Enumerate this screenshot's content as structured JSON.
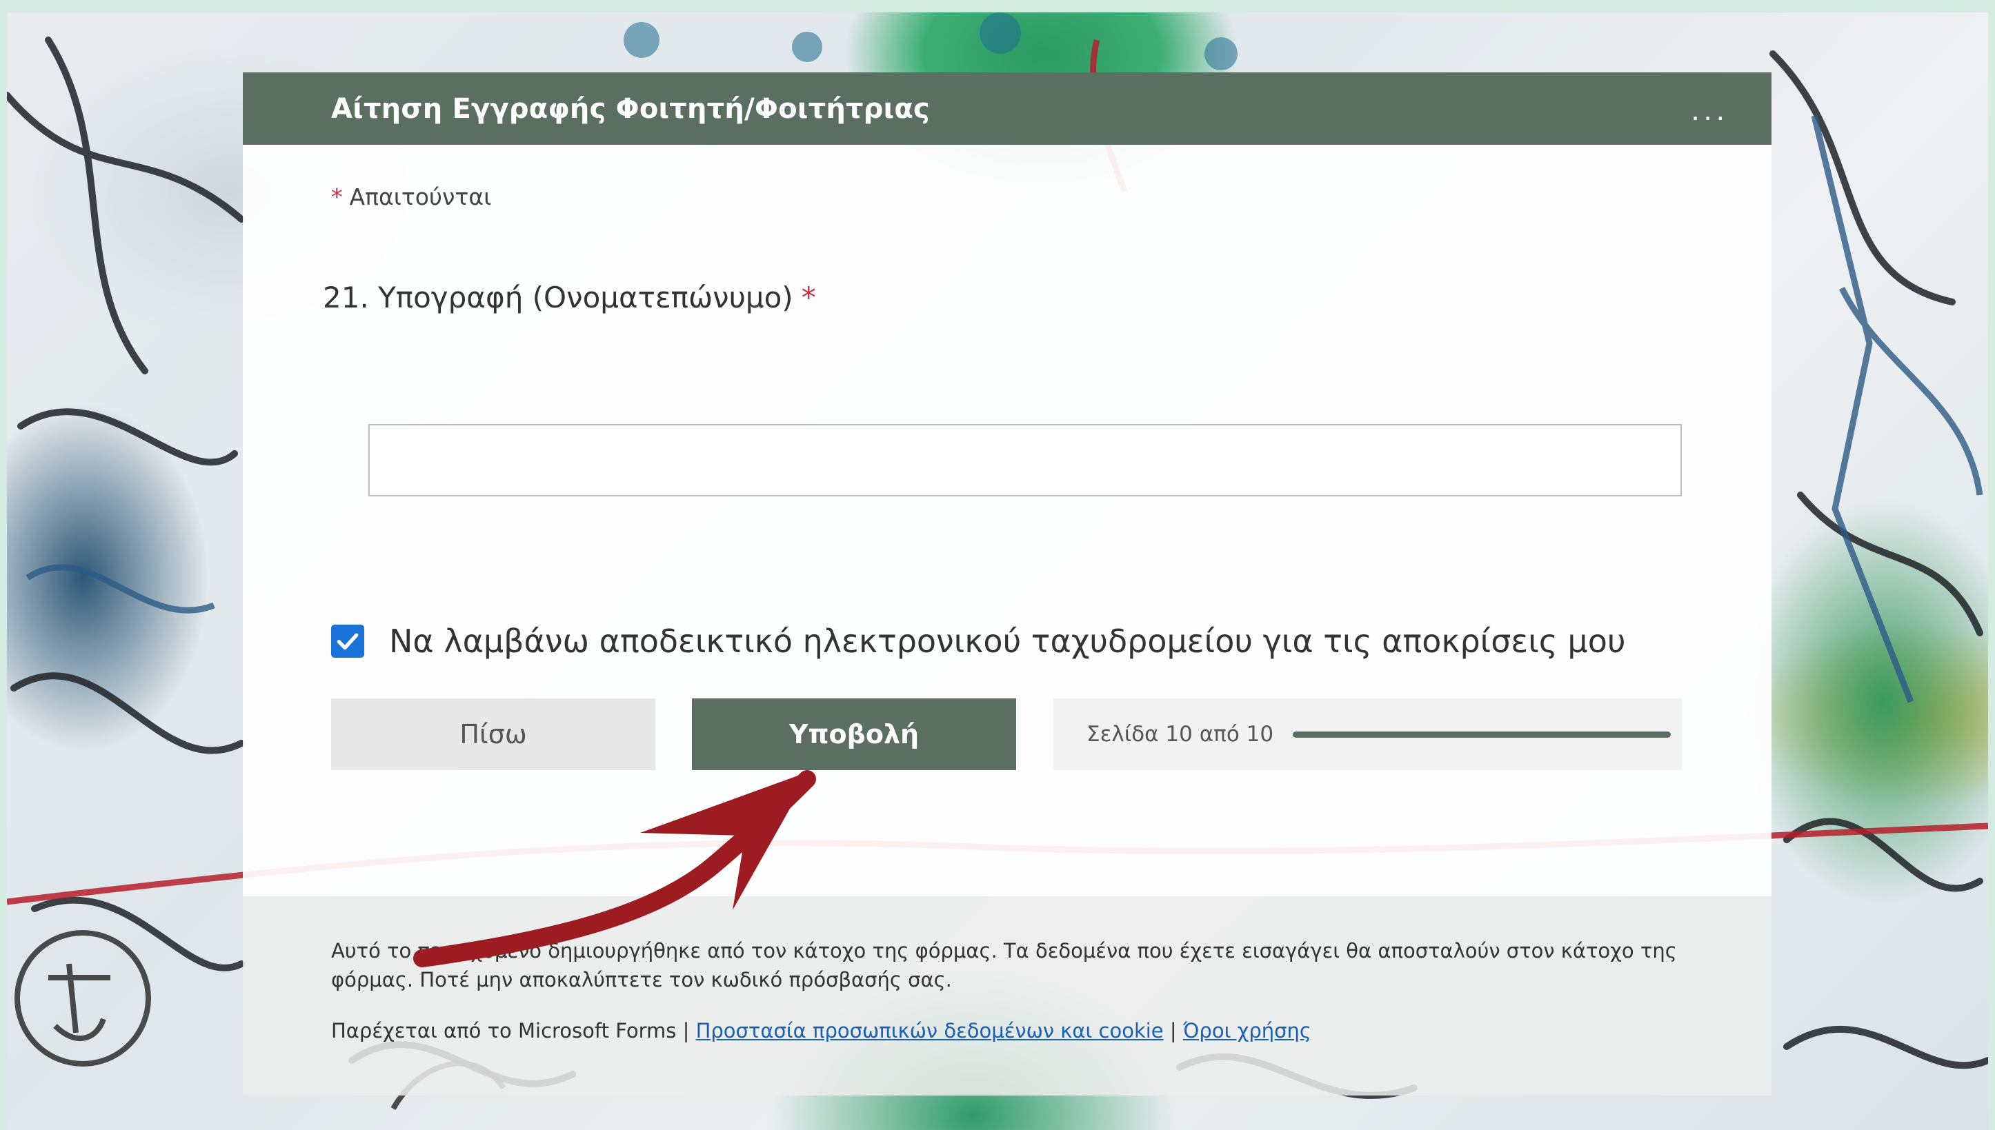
{
  "form": {
    "title": "Αίτηση Εγγραφής Φοιτητή/Φοιτήτριας",
    "more_icon": "more-horizontal-icon",
    "more_label": "...",
    "required_asterisk": "*",
    "required_note": "Απαιτούνται",
    "question": {
      "number_and_text": "21. Υπογραφή (Ονοματεπώνυμο)",
      "asterisk": "*",
      "value": "",
      "placeholder": ""
    },
    "receipt": {
      "checked": true,
      "icon": "checkmark-icon",
      "label": "Να λαμβάνω αποδεικτικό ηλεκτρονικού ταχυδρομείου για τις αποκρίσεις μου"
    },
    "back_label": "Πίσω",
    "submit_label": "Υποβολή",
    "progress": {
      "label": "Σελίδα 10 από 10",
      "current_page": 10,
      "total_pages": 10,
      "fraction": 1.0
    }
  },
  "footer": {
    "disclaimer": "Αυτό το περιεχόμενο δημιουργήθηκε από τον κάτοχο της φόρμας. Τα δεδομένα που έχετε εισαγάγει θα αποσταλούν στον κάτοχο της φόρμας. Ποτέ μην αποκαλύπτετε τον κωδικό πρόσβασής σας.",
    "provided_by": "Παρέχεται από το Microsoft Forms |",
    "privacy_link": "Προστασία προσωπικών δεδομένων και cookie",
    "separator": "|",
    "terms_link": "Όροι χρήσης"
  },
  "colors": {
    "header": "#5b6e62",
    "submit": "#5b6e62",
    "checkbox": "#1a73d9",
    "required": "#c4314b",
    "arrow": "#9c1c22"
  }
}
